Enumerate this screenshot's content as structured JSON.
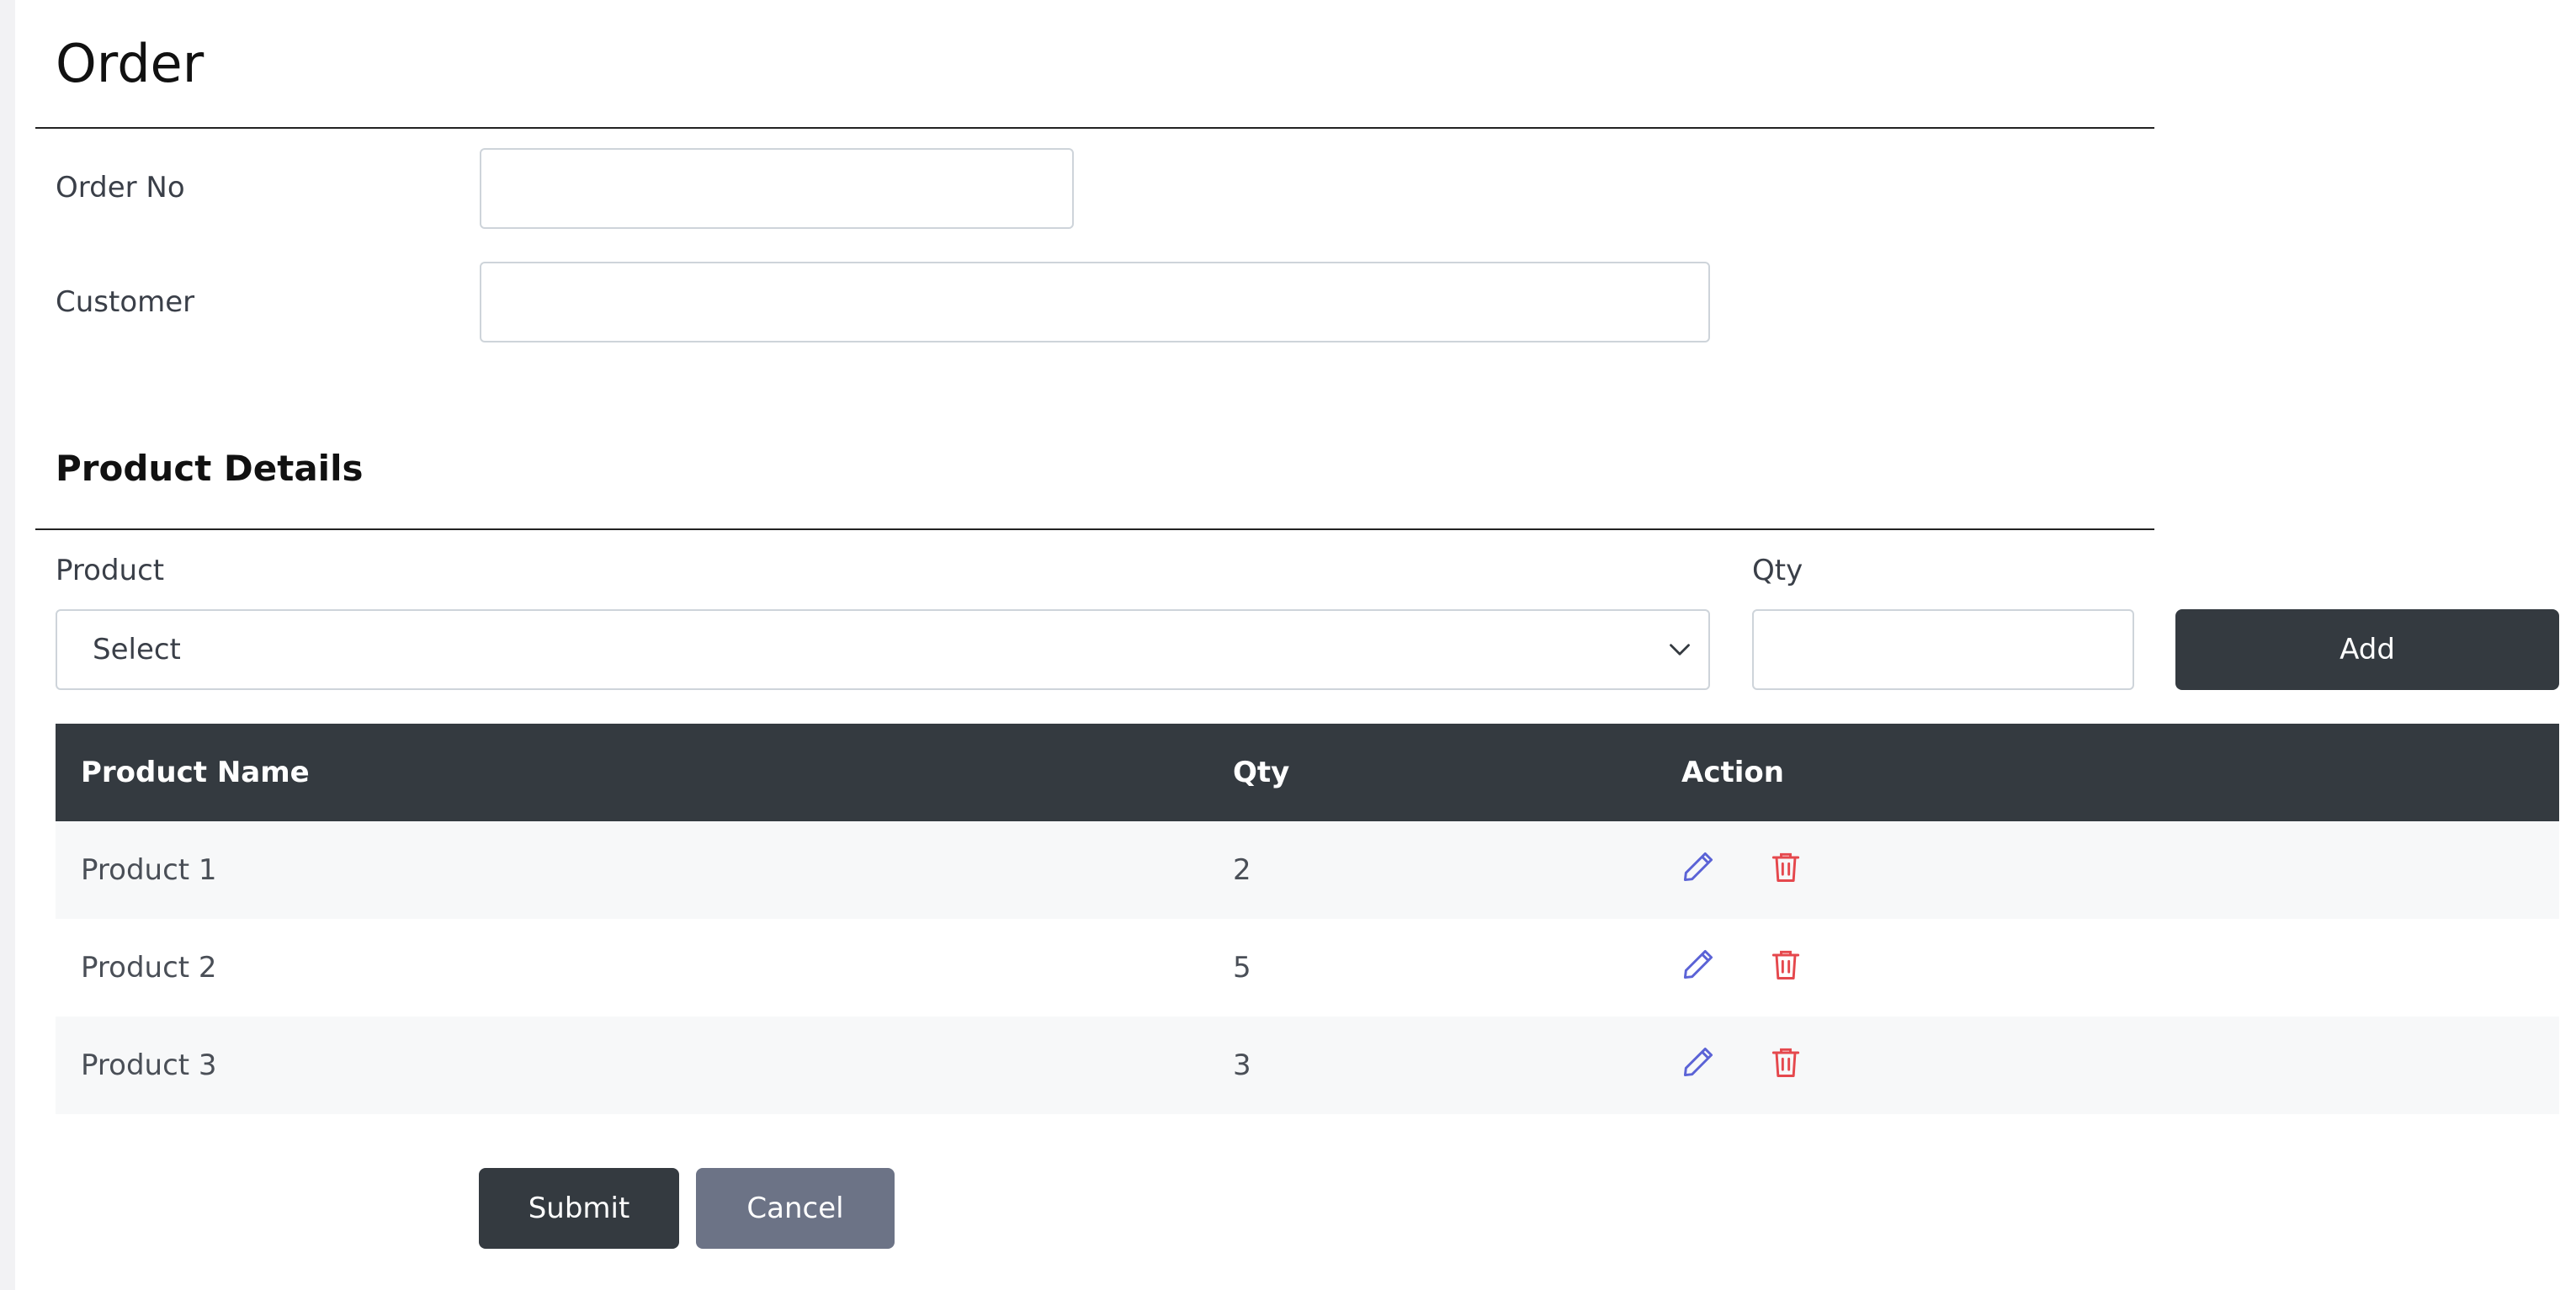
{
  "page": {
    "title": "Order"
  },
  "order_form": {
    "order_no_label": "Order No",
    "order_no_value": "",
    "customer_label": "Customer",
    "customer_value": ""
  },
  "product_details": {
    "title": "Product Details",
    "product_label": "Product",
    "product_select_value": "Select",
    "qty_label": "Qty",
    "qty_value": "",
    "add_button": "Add"
  },
  "table": {
    "columns": [
      "Product Name",
      "Qty",
      "Action"
    ],
    "rows": [
      {
        "name": "Product 1",
        "qty": "2"
      },
      {
        "name": "Product 2",
        "qty": "5"
      },
      {
        "name": "Product 3",
        "qty": "3"
      }
    ]
  },
  "actions": {
    "submit_label": "Submit",
    "cancel_label": "Cancel"
  },
  "colors": {
    "edit_icon": "#5b63d6",
    "delete_icon": "#e5484d",
    "dark": "#343a40",
    "muted_button": "#6c7386"
  },
  "icons": {
    "edit": "pencil-icon",
    "delete": "trash-icon",
    "select": "chevron-down-icon"
  }
}
